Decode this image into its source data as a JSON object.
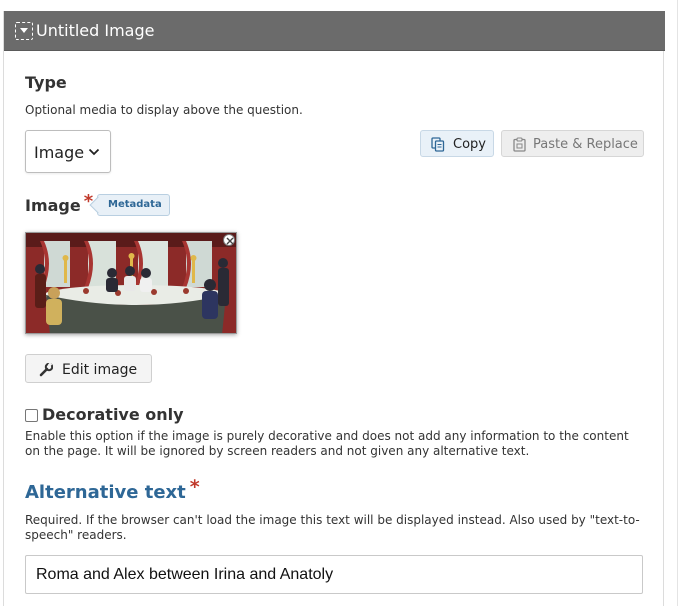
{
  "header": {
    "title": "Untitled Image",
    "collapse_icon": "collapse-dropdown-icon",
    "color": "#6b6b6b"
  },
  "type_field": {
    "label": "Type",
    "description": "Optional media to display above the question.",
    "selected": "Image",
    "copy_label": "Copy",
    "paste_label": "Paste & Replace"
  },
  "image_field": {
    "label": "Image",
    "required_mark": "*",
    "metadata_label": "Metadata",
    "edit_label": "Edit image"
  },
  "decorative": {
    "label": "Decorative only",
    "checked": false,
    "description": "Enable this option if the image is purely decorative and does not add any information to the content on the page. It will be ignored by screen readers and not given any alternative text."
  },
  "alt_text": {
    "label": "Alternative text",
    "required_mark": "*",
    "description": "Required. If the browser can't load the image this text will be displayed instead. Also used by \"text-to-speech\" readers.",
    "value": "Roma and Alex between Irina and Anatoly"
  },
  "colors": {
    "accent": "#2e6796",
    "required": "#c0392b",
    "copy_bg": "#e9f1f8"
  }
}
